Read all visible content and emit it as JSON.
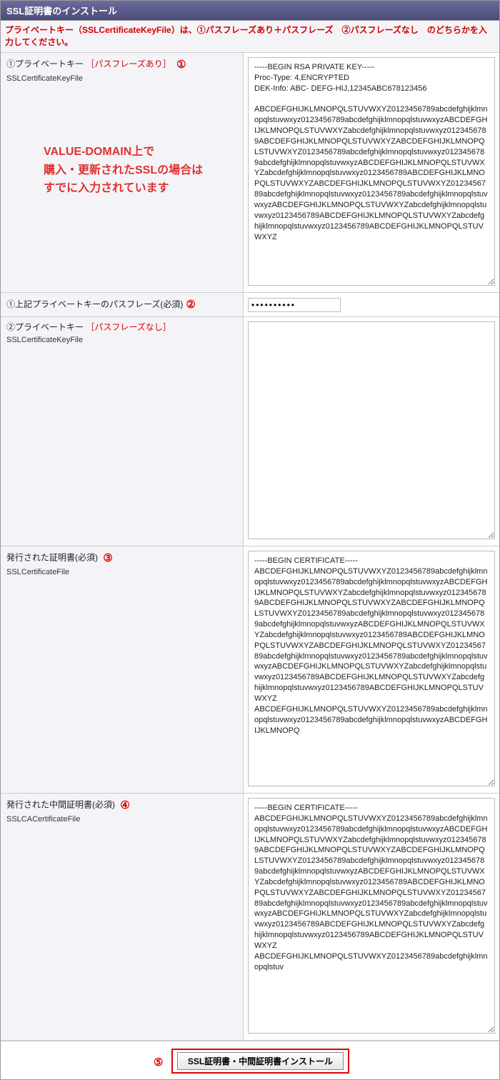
{
  "header": {
    "title": "SSL証明書のインストール"
  },
  "notice": "プライベートキー（SSLCertificateKeyFile）は、①パスフレーズあり＋パスフレーズ　②パスフレーズなし　のどちらかを入力してください。",
  "rows": {
    "pkey_with": {
      "label": "①プライベートキー",
      "hint": "［パスフレーズあり］",
      "sub": "SSLCertificateKeyFile",
      "num": "①",
      "value": "-----BEGIN RSA PRIVATE KEY-----\nProc-Type: 4,ENCRYPTED\nDEK-Info: ABC- DEFG-HIJ,12345ABC678123456\n\nABCDEFGHIJKLMNOPQLSTUVWXYZ0123456789abcdefghijklmnopqlstuvwxyz0123456789abcdefghijklmnopqlstuvwxyzABCDEFGHIJKLMNOPQLSTUVWXYZabcdefghijklmnopqlstuvwxyz0123456789ABCDEFGHIJKLMNOPQLSTUVWXYZABCDEFGHIJKLMNOPQLSTUVWXYZ0123456789abcdefghijklmnopqlstuvwxyz0123456789abcdefghijklmnopqlstuvwxyzABCDEFGHIJKLMNOPQLSTUVWXYZabcdefghijklmnopqlstuvwxyz0123456789ABCDEFGHIJKLMNOPQLSTUVWXYZABCDEFGHIJKLMNOPQLSTUVWXYZ0123456789abcdefghijklmnopqlstuvwxyz0123456789abcdefghijklmnopqlstuvwxyzABCDEFGHIJKLMNOPQLSTUVWXYZabcdefghijklmnopqlstuvwxyz0123456789ABCDEFGHIJKLMNOPQLSTUVWXYZabcdefghijklmnopqlstuvwxyz0123456789ABCDEFGHIJKLMNOPQLSTUVWXYZ"
    },
    "overlay": "VALUE-DOMAIN上で\n購入・更新されたSSLの場合は\nすでに入力されています",
    "passphrase": {
      "label": "①上記プライベートキーのパスフレーズ(必須)",
      "num": "②",
      "value": "●●●●●●●●●●"
    },
    "pkey_without": {
      "label": "②プライベートキー",
      "hint": "［パスフレーズなし］",
      "sub": "SSLCertificateKeyFile",
      "value": ""
    },
    "cert": {
      "label": "発行された証明書(必須)",
      "sub": "SSLCertificateFile",
      "num": "③",
      "value": "-----BEGIN CERTIFICATE-----\nABCDEFGHIJKLMNOPQLSTUVWXYZ0123456789abcdefghijklmnopqlstuvwxyz0123456789abcdefghijklmnopqlstuvwxyzABCDEFGHIJKLMNOPQLSTUVWXYZabcdefghijklmnopqlstuvwxyz0123456789ABCDEFGHIJKLMNOPQLSTUVWXYZABCDEFGHIJKLMNOPQLSTUVWXYZ0123456789abcdefghijklmnopqlstuvwxyz0123456789abcdefghijklmnopqlstuvwxyzABCDEFGHIJKLMNOPQLSTUVWXYZabcdefghijklmnopqlstuvwxyz0123456789ABCDEFGHIJKLMNOPQLSTUVWXYZABCDEFGHIJKLMNOPQLSTUVWXYZ0123456789abcdefghijklmnopqlstuvwxyz0123456789abcdefghijklmnopqlstuvwxyzABCDEFGHIJKLMNOPQLSTUVWXYZabcdefghijklmnopqlstuvwxyz0123456789ABCDEFGHIJKLMNOPQLSTUVWXYZabcdefghijklmnopqlstuvwxyz0123456789ABCDEFGHIJKLMNOPQLSTUVWXYZ\nABCDEFGHIJKLMNOPQLSTUVWXYZ0123456789abcdefghijklmnopqlstuvwxyz0123456789abcdefghijklmnopqlstuvwxyzABCDEFGHIJKLMNOPQ"
    },
    "cacert": {
      "label": "発行された中間証明書(必須)",
      "sub": "SSLCACertificateFile",
      "num": "④",
      "value": "-----BEGIN CERTIFICATE-----\nABCDEFGHIJKLMNOPQLSTUVWXYZ0123456789abcdefghijklmnopqlstuvwxyz0123456789abcdefghijklmnopqlstuvwxyzABCDEFGHIJKLMNOPQLSTUVWXYZabcdefghijklmnopqlstuvwxyz0123456789ABCDEFGHIJKLMNOPQLSTUVWXYZABCDEFGHIJKLMNOPQLSTUVWXYZ0123456789abcdefghijklmnopqlstuvwxyz0123456789abcdefghijklmnopqlstuvwxyzABCDEFGHIJKLMNOPQLSTUVWXYZabcdefghijklmnopqlstuvwxyz0123456789ABCDEFGHIJKLMNOPQLSTUVWXYZABCDEFGHIJKLMNOPQLSTUVWXYZ0123456789abcdefghijklmnopqlstuvwxyz0123456789abcdefghijklmnopqlstuvwxyzABCDEFGHIJKLMNOPQLSTUVWXYZabcdefghijklmnopqlstuvwxyz0123456789ABCDEFGHIJKLMNOPQLSTUVWXYZabcdefghijklmnopqlstuvwxyz0123456789ABCDEFGHIJKLMNOPQLSTUVWXYZ\nABCDEFGHIJKLMNOPQLSTUVWXYZ0123456789abcdefghijklmnopqlstuv"
    }
  },
  "submit": {
    "num": "⑤",
    "label": "SSL証明書・中間証明書インストール"
  }
}
